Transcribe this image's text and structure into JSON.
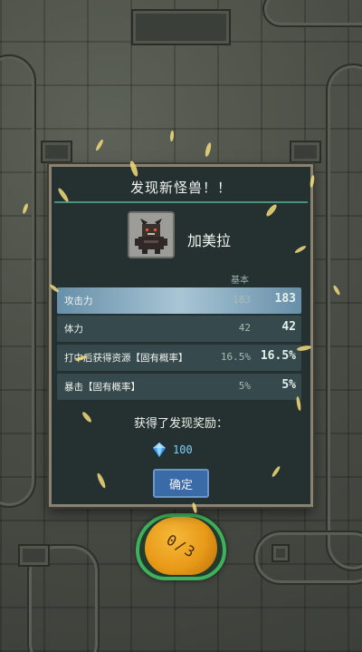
{
  "dialog": {
    "title": "发现新怪兽！！",
    "monster_name": "加美拉",
    "columns": {
      "base": "基本",
      "new": ""
    },
    "stats": [
      {
        "label": "攻击力",
        "base": "183",
        "new": "183",
        "highlighted": true
      },
      {
        "label": "体力",
        "base": "42",
        "new": "42",
        "highlighted": false
      },
      {
        "label": "打中后获得资源【固有概率】",
        "base": "16.5%",
        "new": "16.5%",
        "highlighted": false
      },
      {
        "label": "暴击【固有概率】",
        "base": "5%",
        "new": "5%",
        "highlighted": false
      }
    ],
    "reward_title": "获得了发现奖励：",
    "reward_amount": "100",
    "reward_icon": "blue-gem-icon",
    "confirm_label": "确定"
  },
  "orb": {
    "counter": "0/3"
  },
  "colors": {
    "dialog_bg": "#243130",
    "dialog_border": "#8a8270",
    "accent_line": "#4f8e78",
    "confirm_button": "#3b6aa8",
    "highlight_row": "#9fc4dc",
    "orb_fill": "#e89a18",
    "orb_ring": "#3fb15c",
    "reward_text": "#7fd0ff"
  }
}
